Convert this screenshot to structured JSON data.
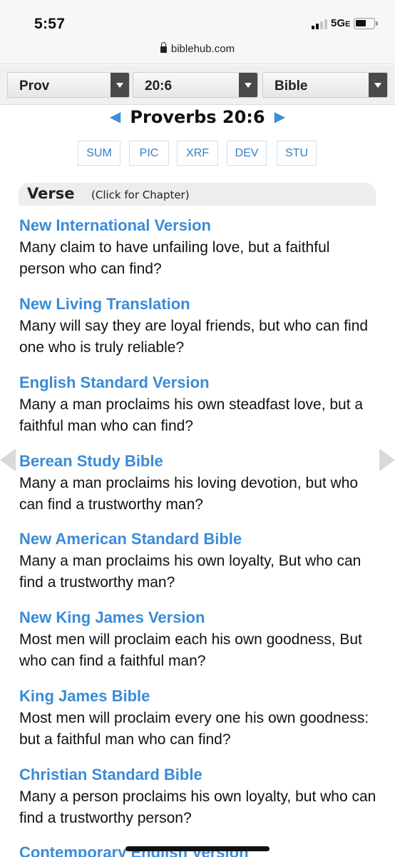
{
  "status_bar": {
    "time": "5:57",
    "network": "5G",
    "network_suffix": "E"
  },
  "browser": {
    "url": "biblehub.com"
  },
  "selectors": [
    {
      "value": "Prov"
    },
    {
      "value": "20:6"
    },
    {
      "value": "Bible"
    }
  ],
  "passage": {
    "title": "Proverbs 20:6",
    "prev_glyph": "◀",
    "next_glyph": "▶"
  },
  "tools": [
    "SUM",
    "PIC",
    "XRF",
    "DEV",
    "STU"
  ],
  "verse_header": {
    "label": "Verse",
    "sub": "(Click for Chapter)"
  },
  "versions": [
    {
      "name": "New International Version",
      "text": "Many claim to have unfailing love, but a faithful person who can find?"
    },
    {
      "name": "New Living Translation",
      "text": "Many will say they are loyal friends, but who can find one who is truly reliable?"
    },
    {
      "name": "English Standard Version",
      "text": "Many a man proclaims his own steadfast love, but a faithful man who can find?"
    },
    {
      "name": "Berean Study Bible",
      "text": "Many a man proclaims his loving devotion, but who can find a trustworthy man?"
    },
    {
      "name": "New American Standard Bible",
      "text": "Many a man proclaims his own loyalty, But who can find a trustworthy man?"
    },
    {
      "name": "New King James Version",
      "text": "Most men will proclaim each his own goodness, But who can find a faithful man?"
    },
    {
      "name": "King James Bible",
      "text": "Most men will proclaim every one his own goodness: but a faithful man who can find?"
    },
    {
      "name": "Christian Standard Bible",
      "text": "Many a person proclaims his own loyalty, but who can find a trustworthy person?"
    },
    {
      "name": "Contemporary English Version",
      "text": ""
    }
  ],
  "colors": {
    "link_blue": "#3a8bd6",
    "selector_arrow": "#4a4a4a"
  }
}
